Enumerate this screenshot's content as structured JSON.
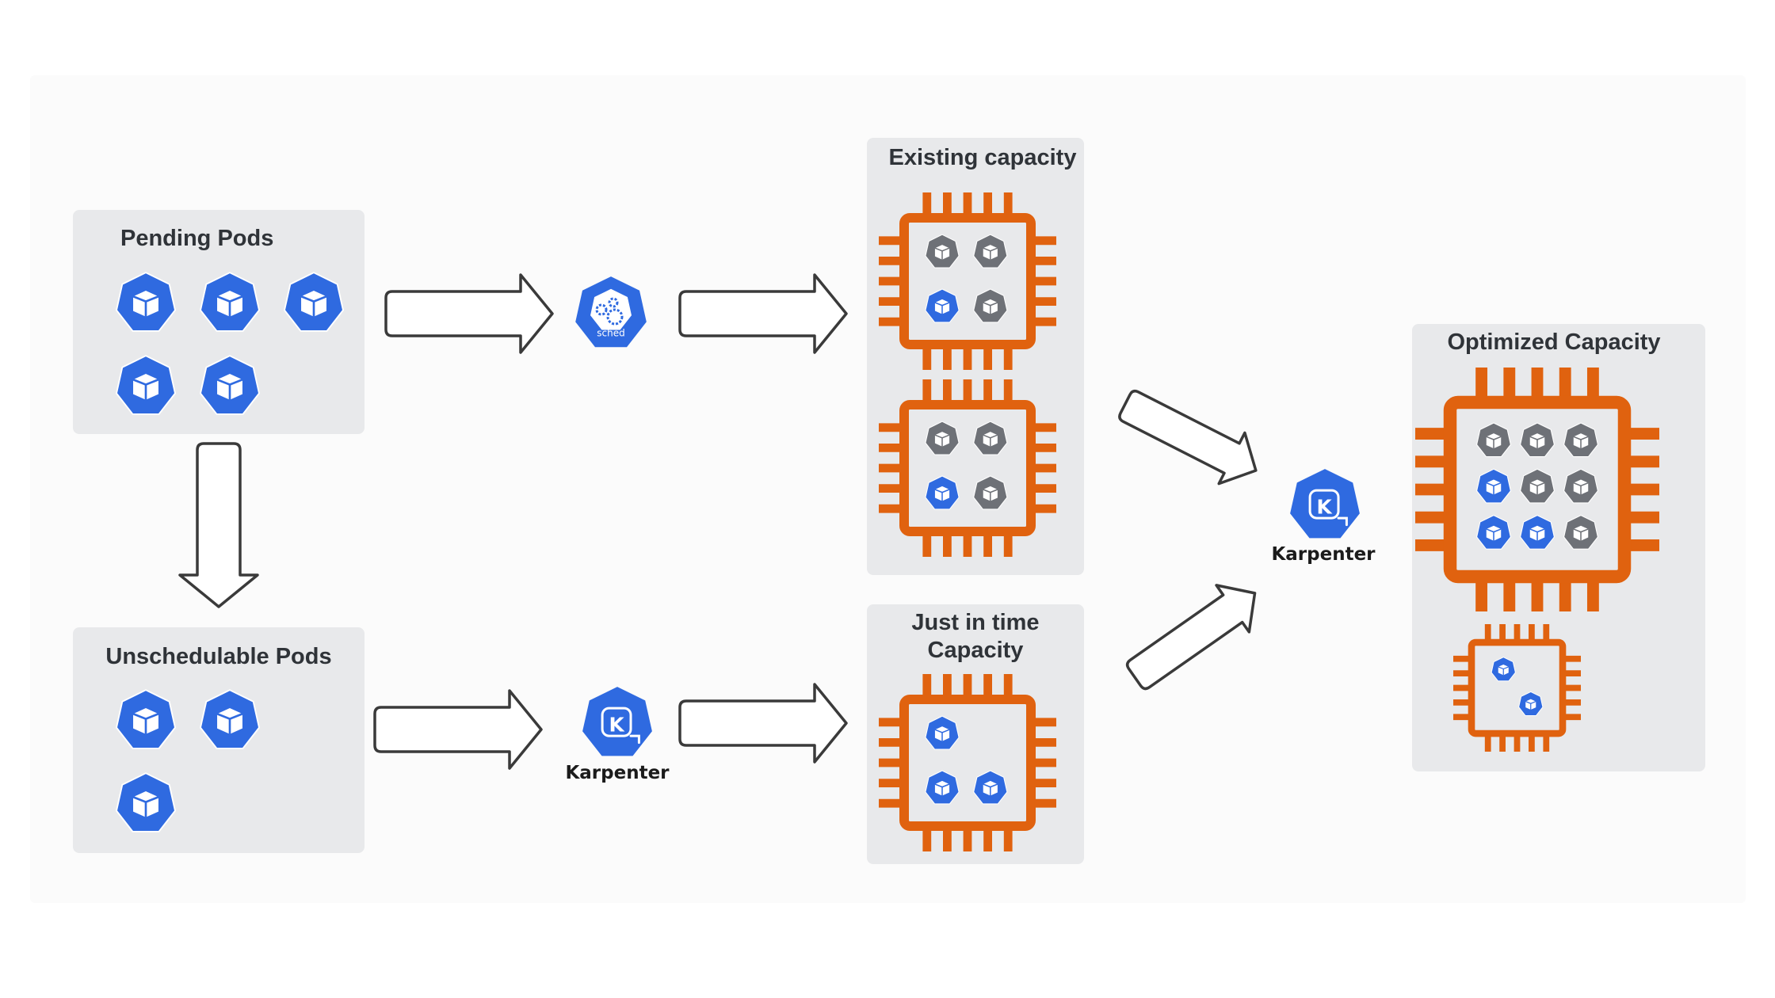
{
  "diagram": {
    "colors": {
      "pod_blue": "#2f6ae0",
      "pod_gray": "#6e7177",
      "chip_orange": "#e0620f",
      "panel_bg": "#e8e9eb",
      "outer_bg": "#fbfbfb",
      "title_text": "#2f3338"
    },
    "panels": {
      "pending": {
        "title": "Pending Pods",
        "pods": [
          "pending",
          "pending",
          "pending",
          "pending",
          "pending"
        ]
      },
      "unschedulable": {
        "title": "Unschedulable Pods",
        "pods": [
          "pending",
          "pending",
          "pending"
        ]
      },
      "existing": {
        "title": "Existing capacity",
        "nodes": [
          {
            "pods": [
              "scheduled-existing",
              "scheduled-existing",
              "newly-scheduled",
              "scheduled-existing"
            ]
          },
          {
            "pods": [
              "scheduled-existing",
              "scheduled-existing",
              "newly-scheduled",
              "scheduled-existing"
            ]
          }
        ]
      },
      "just_in_time": {
        "title_line1": "Just in time",
        "title_line2": "Capacity",
        "nodes": [
          {
            "pods": [
              "newly-scheduled",
              "empty",
              "newly-scheduled",
              "newly-scheduled"
            ]
          }
        ]
      },
      "optimized": {
        "title": "Optimized Capacity",
        "nodes": [
          {
            "size": "large",
            "pods": [
              "scheduled-existing",
              "scheduled-existing",
              "scheduled-existing",
              "newly-scheduled",
              "scheduled-existing",
              "scheduled-existing",
              "newly-scheduled",
              "newly-scheduled",
              "scheduled-existing"
            ]
          },
          {
            "size": "small",
            "pods": [
              "newly-scheduled",
              "newly-scheduled"
            ]
          }
        ]
      }
    },
    "actors": {
      "scheduler": {
        "icon": "kube-scheduler-icon",
        "label": "sched"
      },
      "karpenter_provision": {
        "icon": "karpenter-icon",
        "label": "Karpenter",
        "glyph": "K"
      },
      "karpenter_consolidate": {
        "icon": "karpenter-icon",
        "label": "Karpenter",
        "glyph": "K"
      }
    },
    "flows": [
      {
        "from": "Pending Pods",
        "to": "kube-scheduler"
      },
      {
        "from": "kube-scheduler",
        "to": "Existing capacity"
      },
      {
        "from": "Pending Pods",
        "to": "Unschedulable Pods"
      },
      {
        "from": "Unschedulable Pods",
        "to": "Karpenter"
      },
      {
        "from": "Karpenter",
        "to": "Just in time Capacity"
      },
      {
        "from": "Existing capacity",
        "to": "Karpenter (consolidation)"
      },
      {
        "from": "Just in time Capacity",
        "to": "Karpenter (consolidation)"
      },
      {
        "from": "Karpenter (consolidation)",
        "to": "Optimized Capacity"
      }
    ]
  }
}
